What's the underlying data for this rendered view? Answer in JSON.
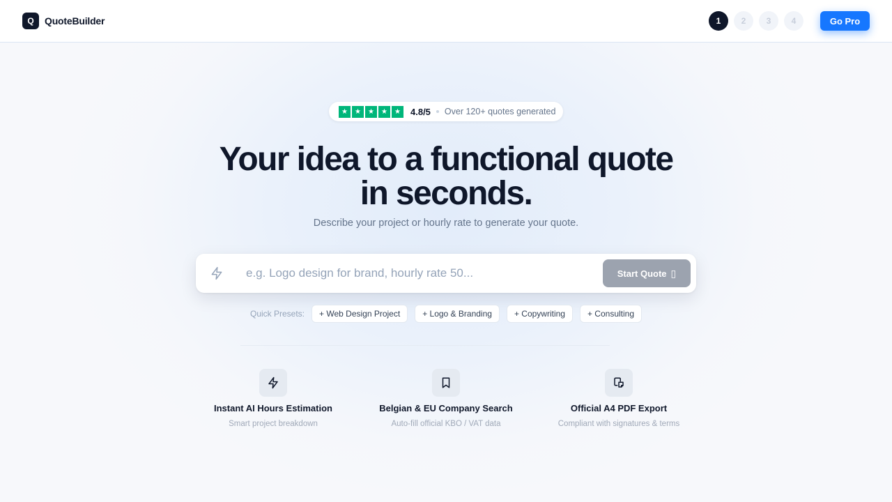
{
  "header": {
    "logo_letter": "Q",
    "brand_name": "QuoteBuilder",
    "steps": [
      "1",
      "2",
      "3",
      "4"
    ],
    "active_step": 1,
    "go_pro_label": "Go Pro"
  },
  "rating": {
    "stars": 5,
    "score": "4.8/5",
    "text": "Over 120+ quotes generated",
    "star_color": "#00b67a"
  },
  "hero": {
    "title_line1": "Your idea to a functional quote",
    "title_line2": "in seconds.",
    "subtitle": "Describe your project or hourly rate to generate your quote."
  },
  "search": {
    "icon": "lightning-icon",
    "value": "",
    "placeholder": "e.g. Logo design for brand, hourly rate 50...",
    "button_label": "Start Quote",
    "button_glyph": "▯"
  },
  "presets": {
    "label": "Quick Presets:",
    "items": [
      "+ Web Design Project",
      "+ Logo & Branding",
      "+ Copywriting",
      "+ Consulting"
    ]
  },
  "features": [
    {
      "icon": "lightning-icon",
      "title": "Instant AI Hours Estimation",
      "desc": "Smart project breakdown"
    },
    {
      "icon": "bookmark-icon",
      "title": "Belgian & EU Company Search",
      "desc": "Auto-fill official KBO / VAT data"
    },
    {
      "icon": "document-export-icon",
      "title": "Official A4 PDF Export",
      "desc": "Compliant with signatures & terms"
    }
  ],
  "colors": {
    "accent": "#1677ff",
    "dark": "#0f172a",
    "muted": "#64748b"
  }
}
